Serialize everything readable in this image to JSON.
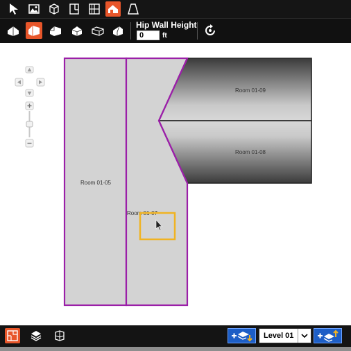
{
  "toolbar": {
    "tools": [
      {
        "name": "select-tool-button",
        "icon": "pointer-icon"
      },
      {
        "name": "image-tool-button",
        "icon": "image-icon"
      },
      {
        "name": "3d-box-tool-button",
        "icon": "cube-icon"
      },
      {
        "name": "door-tool-button",
        "icon": "door-icon"
      },
      {
        "name": "window-tool-button",
        "icon": "window-grid-icon"
      },
      {
        "name": "roof-tool-button",
        "icon": "roof-icon",
        "active": true
      },
      {
        "name": "perspective-tool-button",
        "icon": "trapezoid-icon"
      }
    ]
  },
  "roof_toolbar": {
    "hip_wall_height_label": "Hip Wall Height",
    "hip_wall_height_value": "0",
    "hip_wall_height_unit": "ft",
    "styles": [
      {
        "name": "roof-style-hip",
        "icon": "hip-roof-icon"
      },
      {
        "name": "roof-style-gable",
        "icon": "gable-roof-icon",
        "active": true
      },
      {
        "name": "roof-style-dutch",
        "icon": "dutch-roof-icon"
      },
      {
        "name": "roof-style-mansard",
        "icon": "mansard-roof-icon"
      },
      {
        "name": "roof-style-flat",
        "icon": "flat-roof-icon"
      },
      {
        "name": "roof-style-shed",
        "icon": "shed-roof-icon"
      }
    ],
    "reset_icon": "reset-icon"
  },
  "canvas": {
    "rooms": [
      {
        "label": "Room 01-05"
      },
      {
        "label": "Room 01-07"
      },
      {
        "label": "Room 01-09"
      },
      {
        "label": "Room 01-08"
      }
    ],
    "colors": {
      "wall_outline": "#9b1fa8",
      "room_fill": "#d3d3d3",
      "highlight": "#f0b323"
    }
  },
  "bottom_bar": {
    "level_select_value": "Level 01",
    "add_level_below_icon": "add-level-below-icon",
    "add_level_above_icon": "add-level-above-icon",
    "floorplan_icon": "floorplan-icon",
    "layers_icon": "layers-icon",
    "3d-view-icon": "3d-view-icon"
  }
}
